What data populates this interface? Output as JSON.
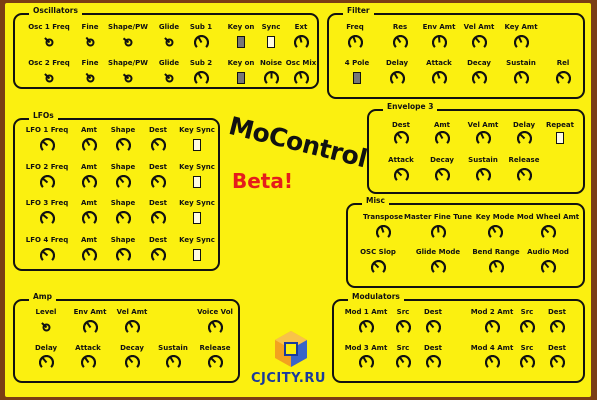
{
  "oscillators": {
    "title": "Oscillators",
    "row1": [
      {
        "label": "Osc 1 Freq",
        "ctrl": "knob",
        "mini": true
      },
      {
        "label": "Fine",
        "ctrl": "knob",
        "mini": true
      },
      {
        "label": "Shape/PW",
        "ctrl": "knob",
        "mini": true
      },
      {
        "label": "Glide",
        "ctrl": "knob",
        "mini": true
      },
      {
        "label": "Sub 1",
        "ctrl": "knob"
      },
      {
        "label": "Key on",
        "ctrl": "toggle",
        "on": true
      },
      {
        "label": "Sync",
        "ctrl": "toggle",
        "on": false
      },
      {
        "label": "Ext",
        "ctrl": "knob"
      }
    ],
    "row2": [
      {
        "label": "Osc 2 Freq",
        "ctrl": "knob",
        "mini": true
      },
      {
        "label": "Fine",
        "ctrl": "knob",
        "mini": true
      },
      {
        "label": "Shape/PW",
        "ctrl": "knob",
        "mini": true
      },
      {
        "label": "Glide",
        "ctrl": "knob",
        "mini": true
      },
      {
        "label": "Sub 2",
        "ctrl": "knob"
      },
      {
        "label": "Key on",
        "ctrl": "toggle",
        "on": true
      },
      {
        "label": "Noise",
        "ctrl": "knob"
      },
      {
        "label": "Osc Mix",
        "ctrl": "knob"
      }
    ]
  },
  "filter": {
    "title": "Filter",
    "row1": [
      {
        "label": "Freq",
        "ctrl": "knob"
      },
      {
        "label": "Res",
        "ctrl": "knob"
      },
      {
        "label": "Env Amt",
        "ctrl": "knob"
      },
      {
        "label": "Vel Amt",
        "ctrl": "knob"
      },
      {
        "label": "Key Amt",
        "ctrl": "knob"
      }
    ],
    "row2": [
      {
        "label": "4 Pole",
        "ctrl": "toggle",
        "on": true
      },
      {
        "label": "Delay",
        "ctrl": "knob"
      },
      {
        "label": "Attack",
        "ctrl": "knob"
      },
      {
        "label": "Decay",
        "ctrl": "knob"
      },
      {
        "label": "Sustain",
        "ctrl": "knob"
      },
      {
        "label": "Rel",
        "ctrl": "knob"
      }
    ]
  },
  "lfos": {
    "title": "LFOs",
    "rows": [
      [
        "LFO 1 Freq",
        "Amt",
        "Shape",
        "Dest",
        "Key Sync"
      ],
      [
        "LFO 2 Freq",
        "Amt",
        "Shape",
        "Dest",
        "Key Sync"
      ],
      [
        "LFO 3 Freq",
        "Amt",
        "Shape",
        "Dest",
        "Key Sync"
      ],
      [
        "LFO 4 Freq",
        "Amt",
        "Shape",
        "Dest",
        "Key Sync"
      ]
    ]
  },
  "envelope3": {
    "title": "Envelope 3",
    "row1": [
      {
        "label": "Dest",
        "ctrl": "knob"
      },
      {
        "label": "Amt",
        "ctrl": "knob"
      },
      {
        "label": "Vel Amt",
        "ctrl": "knob"
      },
      {
        "label": "Delay",
        "ctrl": "knob"
      },
      {
        "label": "Repeat",
        "ctrl": "toggle",
        "on": false
      }
    ],
    "row2": [
      {
        "label": "Attack",
        "ctrl": "knob"
      },
      {
        "label": "Decay",
        "ctrl": "knob"
      },
      {
        "label": "Sustain",
        "ctrl": "knob"
      },
      {
        "label": "Release",
        "ctrl": "knob"
      }
    ]
  },
  "misc": {
    "title": "Misc",
    "row1": [
      "Transpose",
      "Master Fine Tune",
      "Key Mode",
      "Mod Wheel Amt"
    ],
    "row2": [
      "OSC Slop",
      "Glide Mode",
      "Bend Range",
      "Audio Mod"
    ]
  },
  "amp": {
    "title": "Amp",
    "row1": [
      {
        "label": "Level",
        "mini": true
      },
      {
        "label": "Env Amt"
      },
      {
        "label": "Vel Amt"
      },
      {
        "label": "Voice Vol"
      }
    ],
    "row2": [
      "Delay",
      "Attack",
      "Decay",
      "Sustain",
      "Release"
    ]
  },
  "modulators": {
    "title": "Modulators",
    "row1": [
      "Mod 1 Amt",
      "Src",
      "Dest",
      "Mod 2 Amt",
      "Src",
      "Dest"
    ],
    "row2": [
      "Mod 3 Amt",
      "Src",
      "Dest",
      "Mod 4 Amt",
      "Src",
      "Dest"
    ]
  },
  "logo": {
    "text": "MoControl",
    "beta": "Beta!"
  },
  "watermark": {
    "text": "CJCITY.RU"
  }
}
